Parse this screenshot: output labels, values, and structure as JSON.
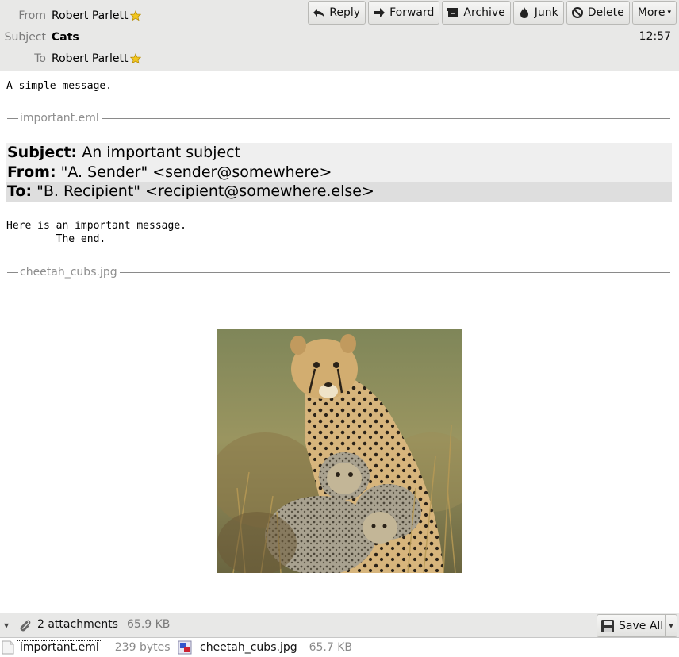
{
  "header": {
    "from_label": "From",
    "from_value": "Robert Parlett",
    "subject_label": "Subject",
    "subject_value": "Cats",
    "to_label": "To",
    "to_value": "Robert Parlett",
    "time": "12:57"
  },
  "toolbar": {
    "reply": "Reply",
    "forward": "Forward",
    "archive": "Archive",
    "junk": "Junk",
    "delete": "Delete",
    "more": "More"
  },
  "body": {
    "intro": "A simple message.",
    "part1_name": "important.eml",
    "embedded": {
      "subject_label": "Subject:",
      "subject_value": "An important subject",
      "from_label": "From:",
      "from_value": "\"A. Sender\" <sender@somewhere>",
      "to_label": "To:",
      "to_value": "\"B. Recipient\" <recipient@somewhere.else>",
      "text_line1": "Here is an important message.",
      "text_line2": "        The end."
    },
    "part2_name": "cheetah_cubs.jpg"
  },
  "attachments": {
    "count_label": "2 attachments",
    "total_size": "65.9 KB",
    "save_all": "Save All",
    "items": [
      {
        "name": "important.eml",
        "size": "239 bytes"
      },
      {
        "name": "cheetah_cubs.jpg",
        "size": "65.7 KB"
      }
    ]
  },
  "colors": {
    "header_bg": "#e8e8e7",
    "star": "#f2c61f",
    "embedded_row_light": "#efefef",
    "embedded_row_dark": "#dedede"
  }
}
